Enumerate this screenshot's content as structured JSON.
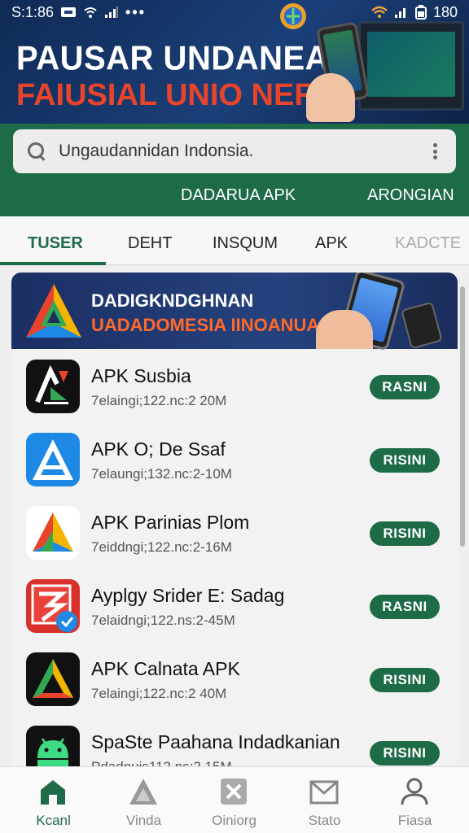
{
  "status_bar": {
    "time": "S:1:86",
    "battery": "180"
  },
  "hero": {
    "title_line1": "PAUSAR UNDANEAN",
    "title_line2": "FAIUSIAL UNIO NERIA"
  },
  "search": {
    "placeholder": "Ungaudannidan Indonsia."
  },
  "subnav": {
    "left": "DADARUA APK",
    "right": "ARONGIAN"
  },
  "tabs": [
    {
      "label": "TUSER"
    },
    {
      "label": "DEHT"
    },
    {
      "label": "INSQUM"
    },
    {
      "label": "APK"
    },
    {
      "label": "KADCTE"
    }
  ],
  "banner": {
    "line1": "DADIGKNDGHNAN",
    "line2": "UADADOMESIA IINOANUA!"
  },
  "apps": [
    {
      "name": "APK Susbia",
      "meta": "7elaingi;122.nc:2 20M",
      "button": "RASNI",
      "icon": "apk-susbia-icon"
    },
    {
      "name": "APK O; De Ssaf",
      "meta": "7elaungi;132.nc:2-10M",
      "button": "RISINI",
      "icon": "apk-ode-ssaf-icon"
    },
    {
      "name": "APK Parinias Plom",
      "meta": "7eiddngi;122.nc:2-16M",
      "button": "RISINI",
      "icon": "apk-parinias-icon"
    },
    {
      "name": "Ayplgy Srider E: Sadag",
      "meta": "7elaidngi;122.ns:2-45M",
      "button": "RASNI",
      "icon": "ayplgy-icon"
    },
    {
      "name": "APK Calnata APK",
      "meta": "7elaingi;122.nc:2 40M",
      "button": "RISINI",
      "icon": "apk-calnata-icon"
    },
    {
      "name": "SpaSte Paahana Indadkanian",
      "meta": "Pdadnuis112 ns:2 15M",
      "button": "RISINI",
      "icon": "android-icon"
    }
  ],
  "bottom_nav": [
    {
      "label": "Kcanl",
      "icon": "home-icon"
    },
    {
      "label": "Vinda",
      "icon": "triangle-icon"
    },
    {
      "label": "Oiniorg",
      "icon": "close-box-icon"
    },
    {
      "label": "Stato",
      "icon": "inbox-icon"
    },
    {
      "label": "Fiasa",
      "icon": "profile-icon"
    }
  ],
  "colors": {
    "primary_green": "#1e6b48",
    "hero_navy": "#1b3f78",
    "accent_red": "#e8432b"
  }
}
